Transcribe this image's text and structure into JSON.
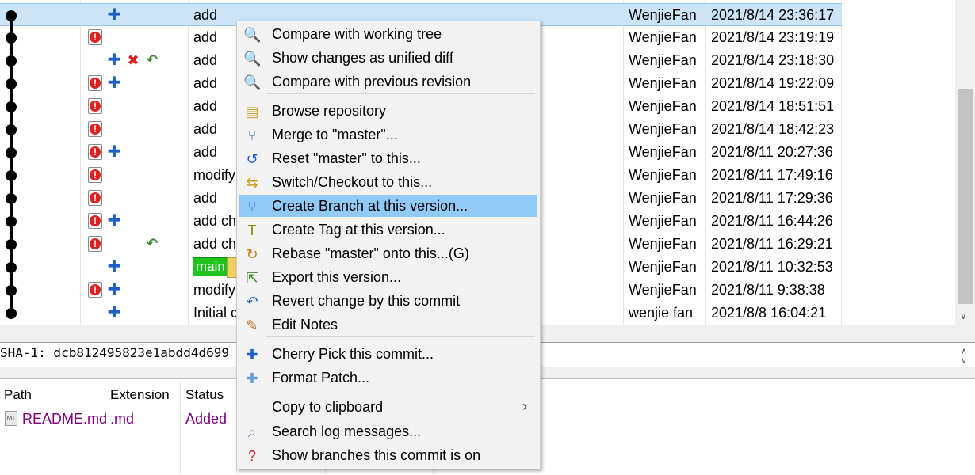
{
  "log": {
    "rows": [
      {
        "message": "add",
        "author": "WenjieFan",
        "date": "2021/8/14 23:36:17",
        "icons": [
          "add"
        ]
      },
      {
        "message": "add",
        "author": "WenjieFan",
        "date": "2021/8/14 23:19:19",
        "icons": [
          "mod"
        ]
      },
      {
        "message": "add",
        "author": "WenjieFan",
        "date": "2021/8/14 23:18:30",
        "icons": [
          "add",
          "del",
          "ren"
        ]
      },
      {
        "message": "add",
        "author": "WenjieFan",
        "date": "2021/8/14 19:22:09",
        "icons": [
          "mod",
          "add"
        ]
      },
      {
        "message": "add",
        "author": "WenjieFan",
        "date": "2021/8/14 18:51:51",
        "icons": [
          "mod"
        ]
      },
      {
        "message": "add",
        "author": "WenjieFan",
        "date": "2021/8/14 18:42:23",
        "icons": [
          "mod"
        ]
      },
      {
        "message": "add",
        "author": "WenjieFan",
        "date": "2021/8/11 20:27:36",
        "icons": [
          "mod",
          "add"
        ]
      },
      {
        "message": "modify",
        "author": "WenjieFan",
        "date": "2021/8/11 17:49:16",
        "icons": [
          "mod"
        ]
      },
      {
        "message": "add",
        "author": "WenjieFan",
        "date": "2021/8/11 17:29:36",
        "icons": [
          "mod"
        ]
      },
      {
        "message": "add ch",
        "author": "WenjieFan",
        "date": "2021/8/11 16:44:26",
        "icons": [
          "mod",
          "add"
        ]
      },
      {
        "message": "add ch",
        "author": "WenjieFan",
        "date": "2021/8/11 16:29:21",
        "icons": [
          "mod",
          "ren"
        ]
      },
      {
        "message": "",
        "author": "WenjieFan",
        "date": "2021/8/11 10:32:53",
        "icons": [
          "add"
        ],
        "branch": "main"
      },
      {
        "message": "modify",
        "author": "WenjieFan",
        "date": "2021/8/11 9:38:38",
        "icons": [
          "mod",
          "add"
        ]
      },
      {
        "message": "Initial c",
        "author": "wenjie fan",
        "date": "2021/8/8 16:04:21",
        "icons": [
          "add"
        ]
      }
    ]
  },
  "sha": {
    "text": "SHA-1: dcb812495823e1abdd4d699"
  },
  "files": {
    "headers": {
      "path": "Path",
      "extension": "Extension",
      "status": "Status"
    },
    "rows": [
      {
        "path": "README.md",
        "extension": ".md",
        "status": "Added"
      }
    ]
  },
  "menu": {
    "items": [
      {
        "label": "Compare with working tree",
        "icon": "magnifier-icon"
      },
      {
        "label": "Show changes as unified diff",
        "icon": "magnifier-icon"
      },
      {
        "label": "Compare with previous revision",
        "icon": "magnifier-icon"
      },
      {
        "label": "Browse repository",
        "icon": "repository-icon"
      },
      {
        "label": "Merge to \"master\"...",
        "icon": "merge-icon"
      },
      {
        "label": "Reset \"master\" to this...",
        "icon": "reset-icon"
      },
      {
        "label": "Switch/Checkout to this...",
        "icon": "checkout-icon"
      },
      {
        "label": "Create Branch at this version...",
        "icon": "branch-icon"
      },
      {
        "label": "Create Tag at this version...",
        "icon": "tag-icon"
      },
      {
        "label": "Rebase \"master\" onto this...(G)",
        "icon": "rebase-icon"
      },
      {
        "label": "Export this version...",
        "icon": "export-icon"
      },
      {
        "label": "Revert change by this commit",
        "icon": "revert-icon"
      },
      {
        "label": "Edit Notes",
        "icon": "edit-notes-icon"
      },
      {
        "label": "Cherry Pick this commit...",
        "icon": "cherry-pick-icon"
      },
      {
        "label": "Format Patch...",
        "icon": "patch-icon"
      },
      {
        "label": "Copy to clipboard",
        "icon": ""
      },
      {
        "label": "Search log messages...",
        "icon": "search-icon"
      },
      {
        "label": "Show branches this commit is on",
        "icon": "branches-icon"
      }
    ]
  },
  "colors": {
    "selection": "#cce4f7",
    "menu_highlight": "#91c9f7",
    "branch_tag": "#1ec31e",
    "file_text": "#800080"
  }
}
